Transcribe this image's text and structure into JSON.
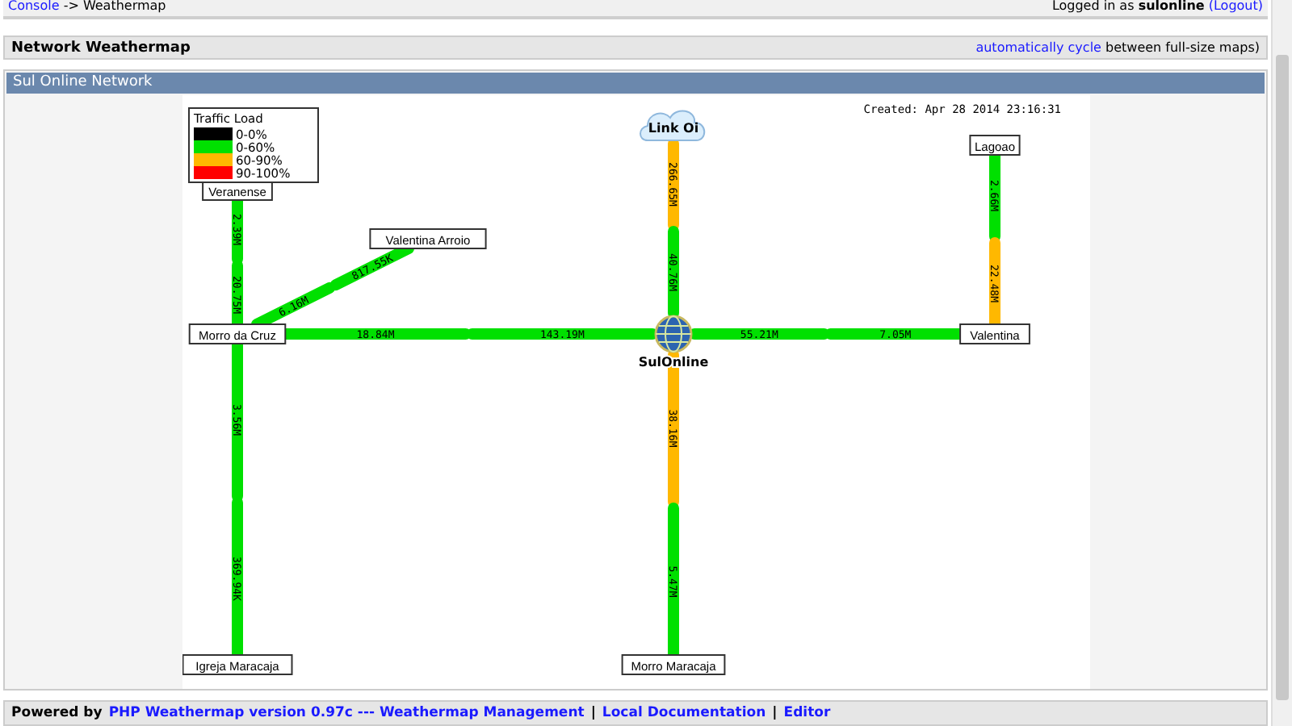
{
  "top_bar": {
    "breadcrumb_link": "Console",
    "breadcrumb_rest": "-> Weathermap",
    "login_prefix": "Logged in as",
    "user": "sulonline",
    "logout": "(Logout)"
  },
  "header": {
    "title": "Network Weathermap",
    "cycle_link": "automatically cycle",
    "cycle_rest": "between full-size maps)"
  },
  "map_title": "Sul Online Network",
  "map": {
    "created": "Created: Apr 28 2014 23:16:31",
    "legend": {
      "title": "Traffic Load",
      "items": [
        {
          "label": "0-0%",
          "color": "#000000"
        },
        {
          "label": "0-60%",
          "color": "#00e000"
        },
        {
          "label": "60-90%",
          "color": "#ffb800"
        },
        {
          "label": "90-100%",
          "color": "#ff0000"
        }
      ]
    },
    "nodes": [
      {
        "kind": "cloud",
        "label": "Link Oi"
      },
      {
        "kind": "box",
        "label": "Lagoao"
      },
      {
        "kind": "box",
        "label": "Veranense"
      },
      {
        "kind": "box",
        "label": "Valentina Arroio"
      },
      {
        "kind": "box",
        "label": "Morro da Cruz"
      },
      {
        "kind": "globe",
        "label": "SulOnline"
      },
      {
        "kind": "box",
        "label": "Valentina"
      },
      {
        "kind": "box",
        "label": "Igreja Maracaja"
      },
      {
        "kind": "box",
        "label": "Morro Maracaja"
      }
    ],
    "links": [
      {
        "out": {
          "label": "2.39M",
          "color": "#00e000"
        },
        "in": {
          "label": "20.75M",
          "color": "#00e000"
        }
      },
      {
        "out": {
          "label": "6.16M",
          "color": "#00e000"
        },
        "in": {
          "label": "817.55K",
          "color": "#00e000"
        }
      },
      {
        "out": {
          "label": "18.84M",
          "color": "#00e000"
        },
        "in": {
          "label": "143.19M",
          "color": "#00e000"
        }
      },
      {
        "out": {
          "label": "266.65M",
          "color": "#ffb800"
        },
        "in": {
          "label": "40.76M",
          "color": "#00e000"
        }
      },
      {
        "out": {
          "label": "55.21M",
          "color": "#00e000"
        },
        "in": {
          "label": "7.05M",
          "color": "#00e000"
        }
      },
      {
        "out": {
          "label": "2.66M",
          "color": "#00e000"
        },
        "in": {
          "label": "22.48M",
          "color": "#ffb800"
        }
      },
      {
        "out": {
          "label": "3.56M",
          "color": "#00e000"
        },
        "in": {
          "label": "369.94K",
          "color": "#00e000"
        }
      },
      {
        "out": {
          "label": "38.16M",
          "color": "#ffb800"
        },
        "in": {
          "label": "5.47M",
          "color": "#00e000"
        }
      }
    ]
  },
  "footer": {
    "prefix": "Powered by",
    "links": [
      "PHP Weathermap version 0.97c --- Weathermap Management",
      "Local Documentation",
      "Editor"
    ],
    "separator": "|"
  }
}
